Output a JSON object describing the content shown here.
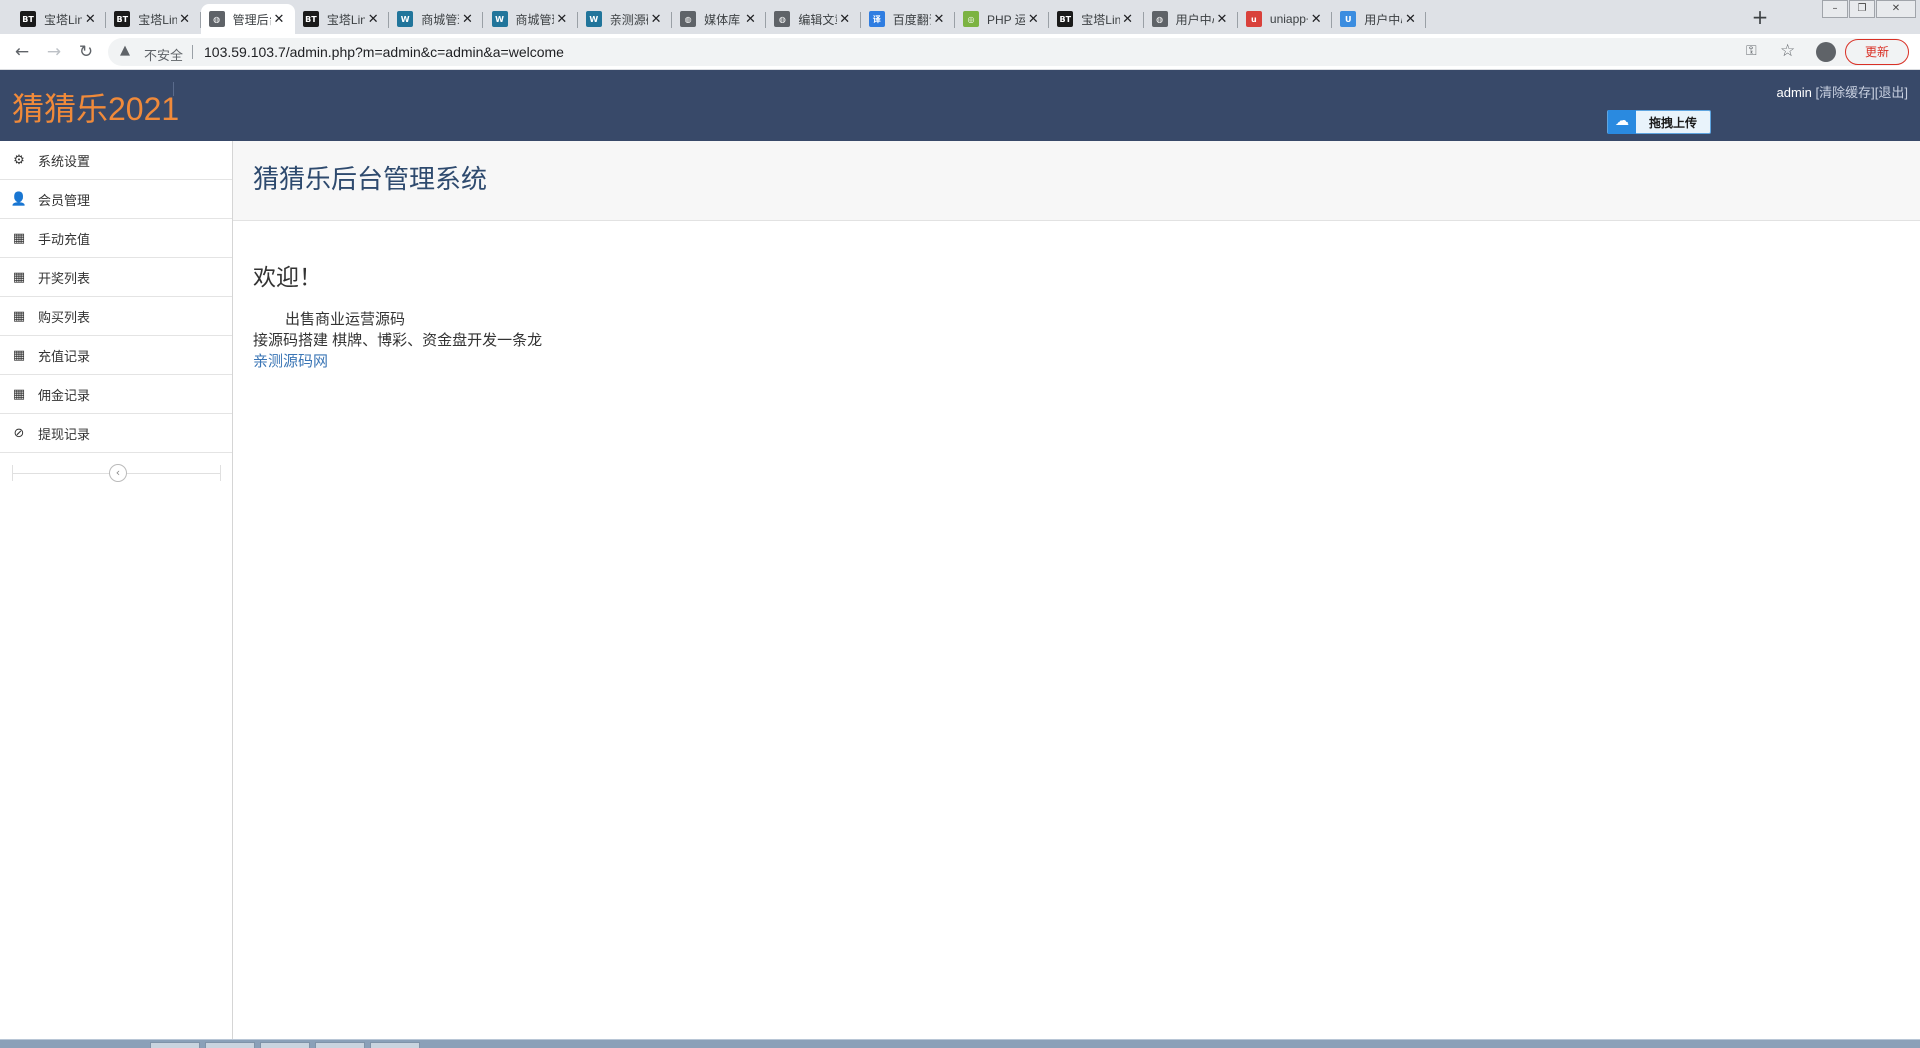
{
  "browser": {
    "tabs": [
      {
        "title": "宝塔Linu",
        "favicon": "bt",
        "active": false
      },
      {
        "title": "宝塔Linu",
        "favicon": "bt",
        "active": false
      },
      {
        "title": "管理后台",
        "favicon": "globe",
        "active": true
      },
      {
        "title": "宝塔Linu",
        "favicon": "bt",
        "active": false
      },
      {
        "title": "商城管理",
        "favicon": "wordpress",
        "active": false
      },
      {
        "title": "商城管理",
        "favicon": "wordpress",
        "active": false
      },
      {
        "title": "亲测源码",
        "favicon": "wordpress",
        "active": false
      },
      {
        "title": "媒体库 ‹",
        "favicon": "globe",
        "active": false
      },
      {
        "title": "编辑文章",
        "favicon": "globe",
        "active": false
      },
      {
        "title": "百度翻译",
        "favicon": "translate",
        "active": false
      },
      {
        "title": "PHP 运算",
        "favicon": "php",
        "active": false
      },
      {
        "title": "宝塔Linu",
        "favicon": "bt",
        "active": false
      },
      {
        "title": "用户中心",
        "favicon": "globe",
        "active": false
      },
      {
        "title": "uniapp+",
        "favicon": "uniapp",
        "active": false
      },
      {
        "title": "用户中心",
        "favicon": "shield",
        "active": false
      }
    ],
    "new_tab_label": "+",
    "insecure_label": "不安全",
    "url": "103.59.103.7/admin.php?m=admin&c=admin&a=welcome",
    "update_label": "更新",
    "colors": {
      "tabstrip": "#dee1e6",
      "update": "#d93025"
    }
  },
  "header": {
    "logo": "猜猜乐2021",
    "user": "admin",
    "clear_cache": "[清除缓存]",
    "logout": "[退出]",
    "upload_label": "拖拽上传",
    "colors": {
      "bg": "#384969",
      "logo": "#f08a3a"
    }
  },
  "sidebar": {
    "items": [
      {
        "label": "系统设置",
        "icon": "gear-icon",
        "glyph": "⚙"
      },
      {
        "label": "会员管理",
        "icon": "user-icon",
        "glyph": "👤"
      },
      {
        "label": "手动充值",
        "icon": "calendar-icon",
        "glyph": "▦"
      },
      {
        "label": "开奖列表",
        "icon": "calendar-icon",
        "glyph": "▦"
      },
      {
        "label": "购买列表",
        "icon": "calendar-icon",
        "glyph": "▦"
      },
      {
        "label": "充值记录",
        "icon": "calendar-icon",
        "glyph": "▦"
      },
      {
        "label": "佣金记录",
        "icon": "calendar-icon",
        "glyph": "▦"
      },
      {
        "label": "提现记录",
        "icon": "ban-icon",
        "glyph": "⊘"
      }
    ]
  },
  "main": {
    "page_title": "猜猜乐后台管理系统",
    "welcome": "欢迎！",
    "line1": "出售商业运营源码",
    "line2": "接源码搭建 棋牌、博彩、资金盘开发一条龙",
    "link": "亲测源码网",
    "colors": {
      "title": "#2e4a6e",
      "link": "#3a75b5"
    }
  }
}
